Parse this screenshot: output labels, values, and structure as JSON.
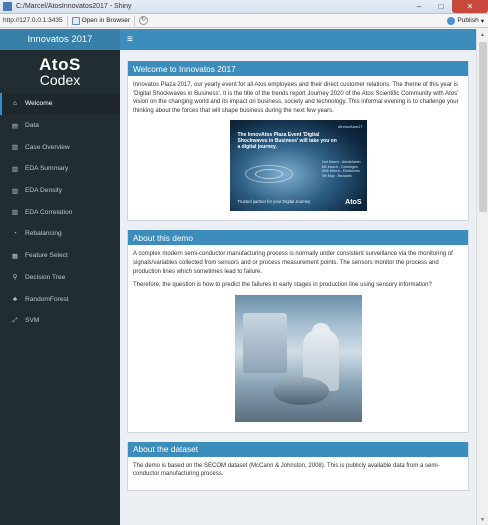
{
  "window": {
    "title": "C:/Marcel/AtosInnovatos2017 - Shiny",
    "minimize": "–",
    "maximize": "□",
    "close": "✕"
  },
  "toolbar": {
    "url": "http://127.0.0.1:3435",
    "open_in_browser": "Open in Browser",
    "publish": "Publish"
  },
  "header": {
    "app_title": "Innovatos 2017",
    "menu_toggle": "≡"
  },
  "sidebar": {
    "brand_line1": "AtoS",
    "brand_line2": "Codex",
    "items": [
      {
        "label": "Welcome",
        "icon": "home-icon",
        "glyph": "⌂"
      },
      {
        "label": "Data",
        "icon": "database-icon",
        "glyph": "▤"
      },
      {
        "label": "Case Overview",
        "icon": "chart-icon",
        "glyph": "▥"
      },
      {
        "label": "EDA Summary",
        "icon": "bar-chart-icon",
        "glyph": "▥"
      },
      {
        "label": "EDA Density",
        "icon": "bar-chart-icon",
        "glyph": "▥"
      },
      {
        "label": "EDA Correlation",
        "icon": "bar-chart-icon",
        "glyph": "▥"
      },
      {
        "label": "Rebalancing",
        "icon": "pie-chart-icon",
        "glyph": "◔"
      },
      {
        "label": "Feature Select",
        "icon": "filter-icon",
        "glyph": "▦"
      },
      {
        "label": "Decision Tree",
        "icon": "tree-icon",
        "glyph": "⚲"
      },
      {
        "label": "RandomForest",
        "icon": "forest-icon",
        "glyph": "♣"
      },
      {
        "label": "SVM",
        "icon": "expand-icon",
        "glyph": "⤢"
      }
    ]
  },
  "main": {
    "welcome": {
      "title": "Welcome to Innovatos 2017",
      "text": "Innovatos Plaza 2017, our yearly event for all Atos employees and their direct customer relations. The theme of this year is 'Digital Shockwaves in Business'. It is the title of the trends report Journey 2020 of the Atos Scientific Community with Atos' vision on the changing world and its impact on business, society and technology. This informal evening is to challenge your thinking about the forces that will shape business during the next few years.",
      "promo": {
        "tag": "#innovAtos17",
        "headline": "The InnovAtos Plaza Event 'Digital Shockwaves in Business' will take you on a digital journey.",
        "dates": "2nd March - Amstelveen\n6th March - Groningen\n30th March - Eindhoven\n9th May - Brussels",
        "partner": "Trusted partner for your Digital Journey",
        "logo": "AtoS"
      }
    },
    "about_demo": {
      "title": "About this demo",
      "p1": "A complex modern semi-conductor manufacturing process is normally under consistent surveillance via the monitoring of signals/variables collected from sensors and or process measurement points. The sensors monitor the process and production lines which sometimes lead to failure.",
      "p2": "Therefore, the question is how to predict the failures in early stages in production line using sensory information?"
    },
    "about_dataset": {
      "title": "About the dataset",
      "text": "The demo is based on the SECOM dataset (McCann & Johnston, 2008). This is publicly available data from a semi-conductor manufacturing process."
    }
  },
  "colors": {
    "navbar": "#3c8dbc",
    "logo_bar": "#367fa9",
    "sidebar": "#222d32"
  }
}
